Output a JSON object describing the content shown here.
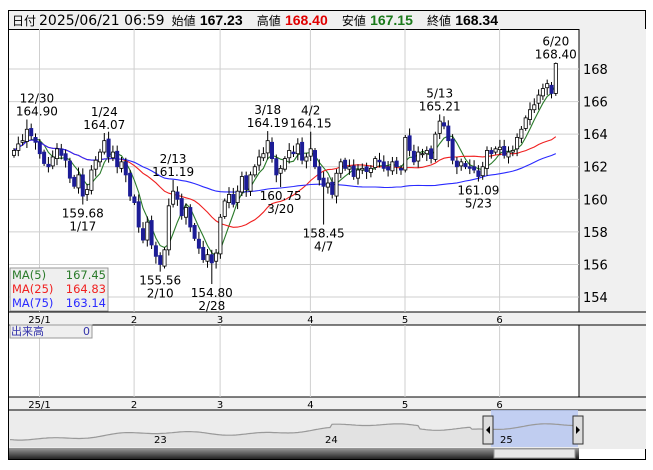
{
  "header": {
    "date_label": "日付",
    "datetime": "2025/06/21 06:59",
    "open_label": "始値",
    "open": "167.23",
    "high_label": "高値",
    "high": "168.40",
    "low_label": "安値",
    "low": "167.15",
    "close_label": "終値",
    "close": "168.34"
  },
  "legend": {
    "ma5_label": "MA(5)",
    "ma5_value": "167.45",
    "ma25_label": "MA(25)",
    "ma25_value": "164.83",
    "ma75_label": "MA(75)",
    "ma75_value": "163.14"
  },
  "volume": {
    "label": "出来高",
    "value": "0"
  },
  "colors": {
    "up": "#ffffff",
    "down": "#1c1c96",
    "ma5": "#2a7a2a",
    "ma25": "#f02020",
    "ma75": "#2a2aff",
    "nav_sel": "#b8c8f4"
  },
  "chart_data": {
    "type": "candlestick",
    "title": "",
    "ylim": [
      153,
      170
    ],
    "y_ticks": [
      "154",
      "156",
      "158",
      "160",
      "162",
      "164",
      "166",
      "168"
    ],
    "months": [
      {
        "label": "25/1",
        "start_index": 5
      },
      {
        "label": "2",
        "start_index": 27
      },
      {
        "label": "3",
        "start_index": 47
      },
      {
        "label": "4",
        "start_index": 68
      },
      {
        "label": "5",
        "start_index": 90
      },
      {
        "label": "6",
        "start_index": 112
      }
    ],
    "closes": [
      163.0,
      163.4,
      163.6,
      164.3,
      163.9,
      163.5,
      162.8,
      162.2,
      162.0,
      162.6,
      163.1,
      162.7,
      162.4,
      161.3,
      160.8,
      161.5,
      160.2,
      160.6,
      161.8,
      162.4,
      162.9,
      163.6,
      162.6,
      162.9,
      162.0,
      162.3,
      161.5,
      160.2,
      159.8,
      158.3,
      157.5,
      158.6,
      157.2,
      156.5,
      156.0,
      156.9,
      159.6,
      160.5,
      160.0,
      159.0,
      159.5,
      158.3,
      157.6,
      157.0,
      156.3,
      156.6,
      156.1,
      156.7,
      158.9,
      159.9,
      160.3,
      159.7,
      160.5,
      161.4,
      160.6,
      161.5,
      162.0,
      162.6,
      162.8,
      163.6,
      162.5,
      161.5,
      161.9,
      162.5,
      163.0,
      162.8,
      163.4,
      162.4,
      162.6,
      163.1,
      162.0,
      161.2,
      160.8,
      161.0,
      160.3,
      161.6,
      162.3,
      161.9,
      162.0,
      161.4,
      161.8,
      161.9,
      161.7,
      161.9,
      162.5,
      162.3,
      161.9,
      161.8,
      162.3,
      162.0,
      161.8,
      163.8,
      163.0,
      162.3,
      162.9,
      162.8,
      163.0,
      162.5,
      164.0,
      164.8,
      164.5,
      163.6,
      162.4,
      162.0,
      162.3,
      162.0,
      161.9,
      161.8,
      161.4,
      162.0,
      163.0,
      162.8,
      163.1,
      163.2,
      162.7,
      162.9,
      163.0,
      163.8,
      164.3,
      165.0,
      165.5,
      165.8,
      166.4,
      166.8,
      167.1,
      166.5,
      168.34
    ],
    "annotations": [
      {
        "date": "12/30",
        "value": "164.90",
        "index": 3,
        "pos": "above"
      },
      {
        "date": "1/17",
        "value": "159.68",
        "index": 16,
        "pos": "below"
      },
      {
        "date": "1/24",
        "value": "164.07",
        "index": 21,
        "pos": "above"
      },
      {
        "date": "2/10",
        "value": "155.56",
        "index": 34,
        "pos": "below"
      },
      {
        "date": "2/13",
        "value": "161.19",
        "index": 37,
        "pos": "above"
      },
      {
        "date": "2/28",
        "value": "154.80",
        "index": 46,
        "pos": "below"
      },
      {
        "date": "3/18",
        "value": "164.19",
        "index": 59,
        "pos": "above"
      },
      {
        "date": "3/20",
        "value": "160.75",
        "index": 62,
        "pos": "below"
      },
      {
        "date": "4/2",
        "value": "164.15",
        "index": 69,
        "pos": "above"
      },
      {
        "date": "4/7",
        "value": "158.45",
        "index": 72,
        "pos": "below"
      },
      {
        "date": "5/13",
        "value": "165.21",
        "index": 99,
        "pos": "above"
      },
      {
        "date": "5/23",
        "value": "161.09",
        "index": 108,
        "pos": "below"
      },
      {
        "date": "6/20",
        "value": "168.40",
        "index": 126,
        "pos": "above"
      }
    ],
    "navigator_years": [
      "23",
      "24",
      "25"
    ]
  }
}
